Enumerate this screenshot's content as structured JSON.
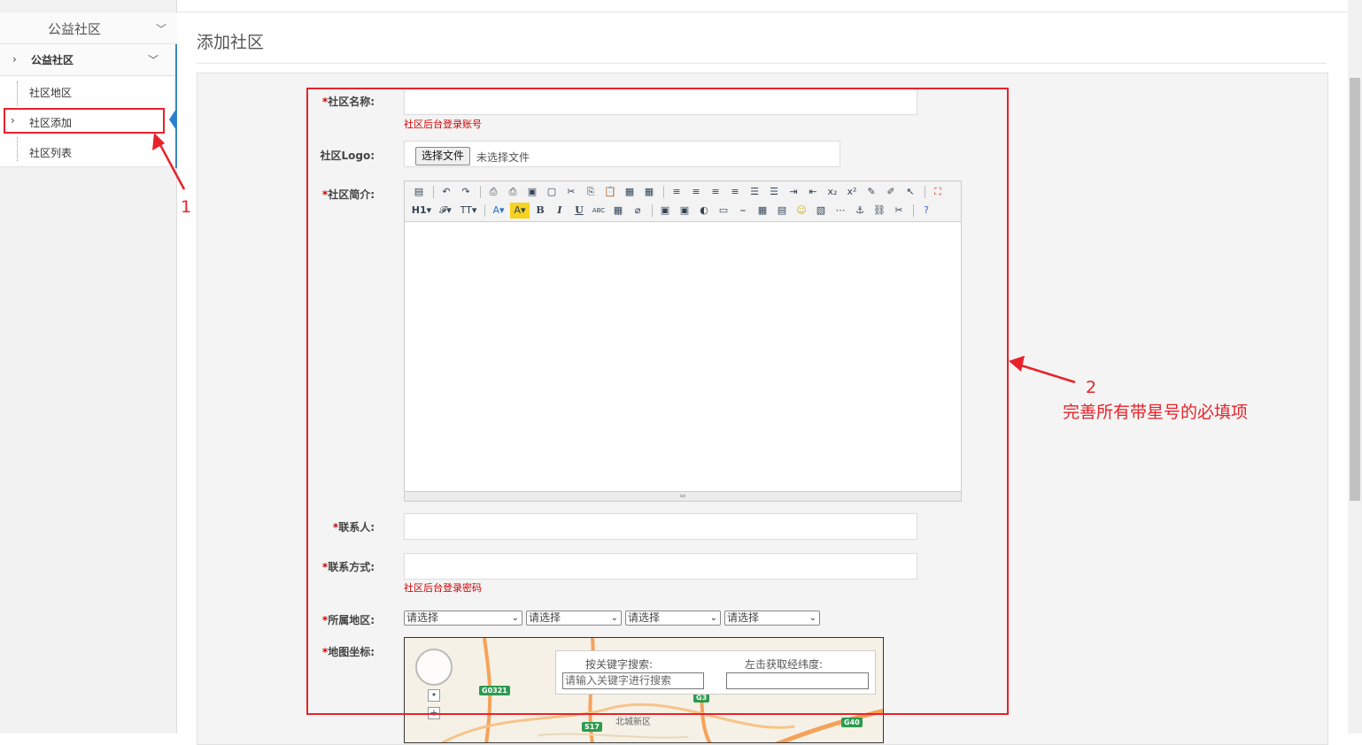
{
  "sidebar": {
    "header": "公益社区",
    "group": "公益社区",
    "items": [
      {
        "label": "社区地区"
      },
      {
        "label": "社区添加"
      },
      {
        "label": "社区列表"
      }
    ]
  },
  "page": {
    "title": "添加社区"
  },
  "form": {
    "name_label": "社区名称:",
    "name_hint": "社区后台登录账号",
    "logo_label": "社区Logo:",
    "file_button": "选择文件",
    "file_status": "未选择文件",
    "intro_label": "社区简介:",
    "contact_label": "联系人:",
    "phone_label": "联系方式:",
    "phone_hint": "社区后台登录密码",
    "region_label": "所属地区:",
    "region_selects": [
      "请选择",
      "请选择",
      "请选择",
      "请选择"
    ],
    "map_label": "地图坐标:",
    "required_mark": "*"
  },
  "editor": {
    "toolbar_row1": [
      "source-icon",
      "undo-icon",
      "redo-icon",
      "preview-icon",
      "print-icon",
      "template-icon",
      "paste-word-icon",
      "cut-icon",
      "copy-icon",
      "paste-icon",
      "paste-text-icon",
      "paste-html-icon",
      "align-left-icon",
      "align-center-icon",
      "align-right-icon",
      "justify-icon",
      "ordered-list-icon",
      "bullet-list-icon",
      "indent-icon",
      "outdent-icon",
      "subscript-icon",
      "superscript-icon",
      "clear-format-icon",
      "select-all-icon",
      "cursor-icon",
      "fullscreen-icon"
    ],
    "toolbar_row2": [
      "H1▾",
      "𝓕▾",
      "TT▾",
      "A▾",
      "A▾",
      "B",
      "I",
      "U",
      "ABC",
      "▦",
      "⌀"
    ],
    "resize_glyph": "⇔"
  },
  "map": {
    "search_label": "按关键字搜索:",
    "search_placeholder": "请输入关键字进行搜索",
    "coord_label": "左击获取经纬度:",
    "road_labels": [
      "G0321",
      "G3",
      "S17",
      "G40"
    ],
    "place_label": "北城新区"
  },
  "annotations": {
    "label1": "1",
    "label2": "2",
    "note2": "完善所有带星号的必填项",
    "color": "#e8222a"
  }
}
